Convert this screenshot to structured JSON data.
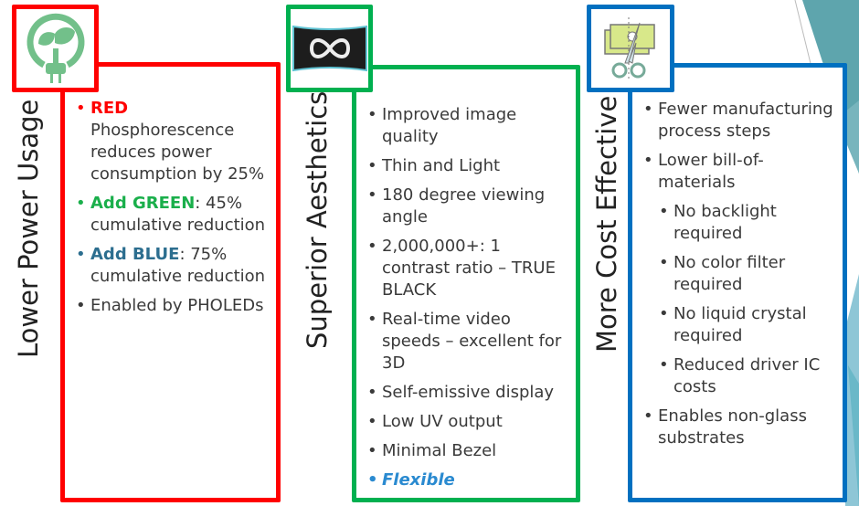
{
  "colors": {
    "red": "#ff0000",
    "green": "#00b050",
    "blue": "#0070c0",
    "teal": "#5aa3ad"
  },
  "columns": [
    {
      "title": "Lower Power Usage",
      "icon": "eco-plug-icon",
      "items": [
        {
          "highlight": "RED",
          "text": " Phosphorescence reduces power consumption by 25%"
        },
        {
          "highlight": "Add GREEN",
          "text": ": 45% cumulative reduction"
        },
        {
          "highlight": "Add BLUE",
          "text": ": 75% cumulative reduction"
        },
        {
          "text": "Enabled by PHOLEDs"
        }
      ]
    },
    {
      "title": "Superior Aesthetics",
      "icon": "infinity-display-icon",
      "items": [
        "Improved image quality",
        "Thin and Light",
        "180 degree viewing angle",
        "2,000,000+: 1 contrast ratio – TRUE BLACK",
        "Real-time video speeds – excellent for 3D",
        "Self-emissive display",
        "Low UV output",
        "Minimal Bezel",
        "Flexible"
      ]
    },
    {
      "title": "More Cost Effective",
      "icon": "money-scissors-icon",
      "items": [
        "Fewer manufacturing process steps",
        "Lower bill-of-materials",
        "No backlight required",
        "No color filter required",
        "No liquid crystal required",
        "Reduced driver IC costs",
        "Enables non-glass substrates"
      ]
    }
  ]
}
